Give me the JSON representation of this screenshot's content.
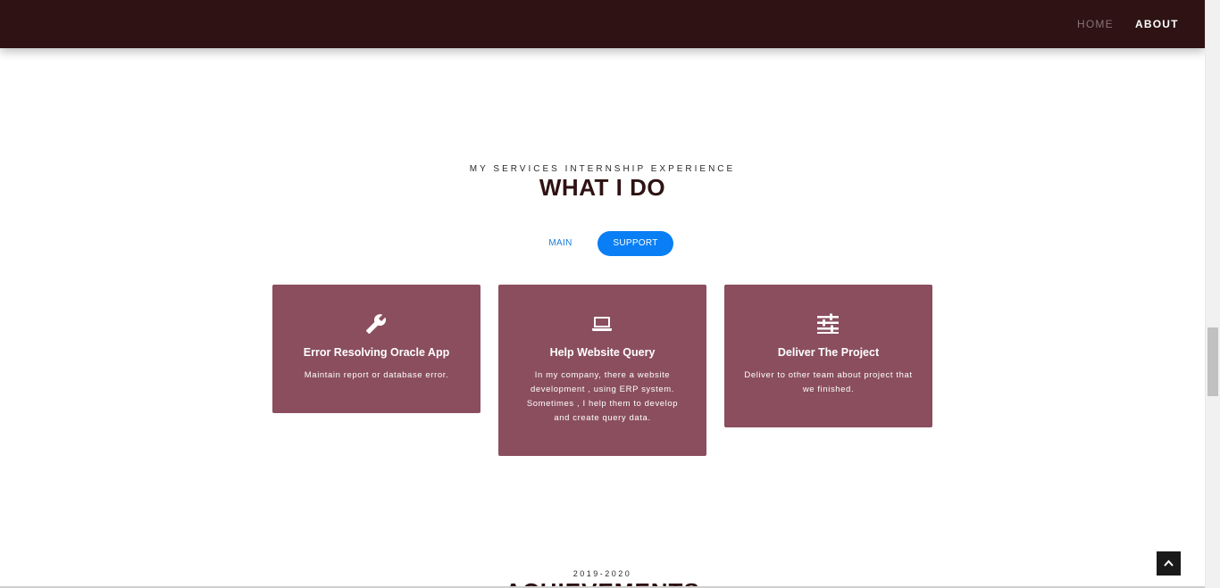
{
  "nav": {
    "home_label": "HOME",
    "about_label": "ABOUT"
  },
  "services": {
    "subtitle": "MY SERVICES INTERNSHIP EXPERIENCE",
    "title": "WHAT I DO",
    "tabs": [
      {
        "label": "MAIN",
        "active": false
      },
      {
        "label": "SUPPORT",
        "active": true
      }
    ],
    "cards": [
      {
        "icon": "wrench-icon",
        "title": "Error Resolving Oracle App",
        "description": "Maintain report or database error."
      },
      {
        "icon": "laptop-icon",
        "title": "Help Website Query",
        "description": "In my company, there a website development , using ERP system. Sometimes , I help them to develop and create query data."
      },
      {
        "icon": "sliders-icon",
        "title": "Deliver The Project",
        "description": "Deliver to other team about project that we finished."
      }
    ]
  },
  "achievements": {
    "subtitle": "2019-2020",
    "title": "ACHIEVEMENTS"
  },
  "colors": {
    "navbar_bg": "#2e1214",
    "card_bg": "#8a4e5f",
    "accent_blue": "#0a7ff5",
    "title_color": "#2e1214"
  }
}
